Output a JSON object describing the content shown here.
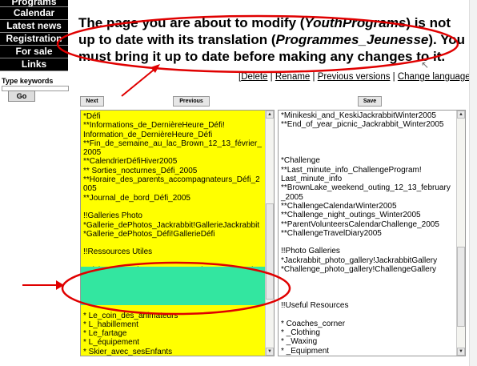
{
  "nav": {
    "items": [
      "Programs",
      "Calendar",
      "Latest news",
      "Registration",
      "For sale",
      "Links"
    ],
    "keywords_label": "Type keywords",
    "go_label": "Go"
  },
  "heading": {
    "part1": "The page you are about to modify (",
    "page_name": "YouthPrograms",
    "part2": ") is not up to date with its translation (",
    "translation_name": "Programmes_Jeunesse",
    "part3": "). You must bring it up to date before making any changes to it."
  },
  "links": {
    "open": "[",
    "delete": "Delete",
    "sep": " | ",
    "rename": "Rename",
    "previous_versions": "Previous versions",
    "change_language": "Change language",
    "close": "]"
  },
  "buttons": {
    "next": "Next",
    "previous": "Previous",
    "save": "Save"
  },
  "left_text": "*Défi\n**Informations_de_DernièreHeure_Défi!\nInformation_de_DernièreHeure_Défi\n**Fin_de_semaine_au_lac_Brown_12_13_février_\n2005\n**CalendrierDéfiHiver2005\n** Sorties_nocturnes_Défi_2005\n**Horaire_des_parents_accompagnateurs_Défi_2\n005\n**Journal_de_bord_Défi_2005\n\n!!Galleries Photo\n*Gallerie_dePhotos_Jackrabbit!GallerieJackrabbit\n*Gallerie_dePhotos_Défi!GallerieDéfi\n\n!!Ressources Utiles\n\nVoici une liste de resources pour les parents qui\nont des enfants dans les programmes_jeunesse\net les animateurs qui oeuvrent dans ces\nprogrammes.\n\n* Le_coin_des_animateurs\n* L_habillement\n* Le_fartage\n* L_équipement\n* Skier_avec_sesEnfants",
  "right_text": "*Minikeski_and_KeskiJackrabbitWinter2005\n**End_of_year_picnic_Jackrabbit_Winter2005\n\n\n\n*Challenge\n**Last_minute_info_ChallengeProgram!\nLast_minute_info\n**BrownLake_weekend_outing_12_13_february\n_2005\n**ChallengeCalendarWinter2005\n**Challenge_night_outings_Winter2005\n**ParentVolunteersCalendarChallenge_2005\n**ChallengeTravelDiary2005\n\n!!Photo Galleries\n*Jackrabbit_photo_gallery!JackrabbitGallery\n*Challenge_photo_gallery!ChallengeGallery\n\n\n\n!!Useful Resources\n\n* Coaches_corner\n* _Clothing\n* _Waxing\n* _Equipment\n* Skiing_with_your_kids",
  "colors": {
    "highlight_left": "#ffff00",
    "highlight_green": "#33e6a0",
    "annotation_red": "#e00000"
  }
}
